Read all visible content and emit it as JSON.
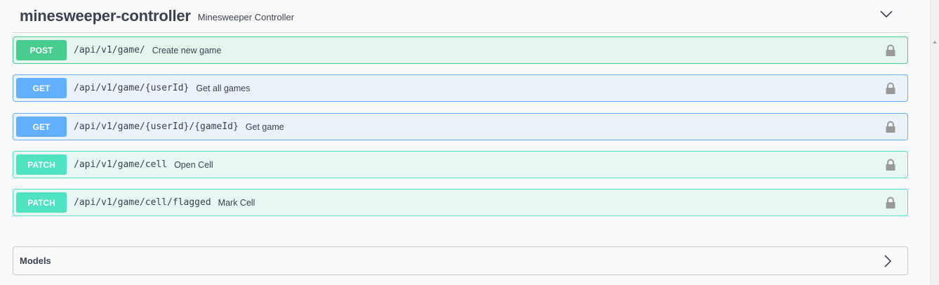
{
  "tag": {
    "name": "minesweeper-controller",
    "description": "Minesweeper Controller"
  },
  "operations": [
    {
      "method": "POST",
      "path": "/api/v1/game/",
      "summary": "Create new game"
    },
    {
      "method": "GET",
      "path": "/api/v1/game/{userId}",
      "summary": "Get all games"
    },
    {
      "method": "GET",
      "path": "/api/v1/game/{userId}/{gameId}",
      "summary": "Get game"
    },
    {
      "method": "PATCH",
      "path": "/api/v1/game/cell",
      "summary": "Open Cell"
    },
    {
      "method": "PATCH",
      "path": "/api/v1/game/cell/flagged",
      "summary": "Mark Cell"
    }
  ],
  "models": {
    "title": "Models"
  },
  "icons": {
    "collapse": "chevron-down-icon",
    "lock": "lock-icon",
    "expand": "chevron-right-icon"
  },
  "colors": {
    "post": "#49cc90",
    "get": "#61affe",
    "patch": "#50e3c2",
    "text": "#3b4151"
  }
}
